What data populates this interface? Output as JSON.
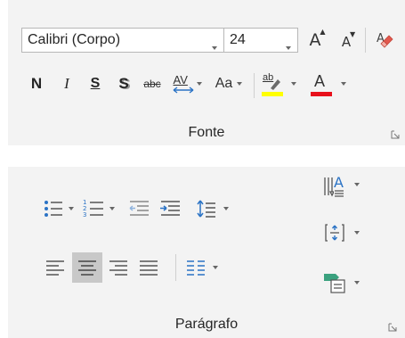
{
  "font": {
    "font_name": "Calibri (Corpo)",
    "font_size": "24",
    "grow_label": "A",
    "shrink_label": "A",
    "bold_label": "N",
    "italic_label": "I",
    "underline_label": "S",
    "shadow_label": "S",
    "strike_label": "abc",
    "spacing_label": "AV",
    "case_label": "Aa",
    "highlight_label": "ab",
    "font_color_label": "A",
    "group_label": "Fonte",
    "colors": {
      "highlight": "#ffff00",
      "font_color": "#e8101b",
      "clear_format": "#e2584e"
    }
  },
  "paragraph": {
    "group_label": "Parágrafo",
    "text_direction_label": "A",
    "colors": {
      "accent": "#2b73c5",
      "smartart": "#3aa17e"
    }
  }
}
